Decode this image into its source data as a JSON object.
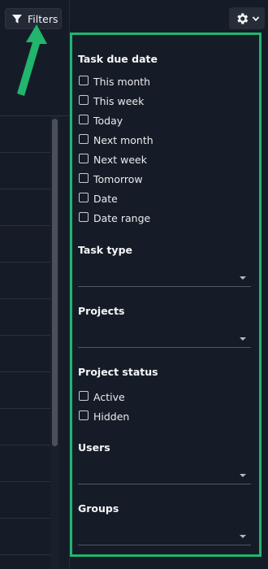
{
  "toolbar": {
    "filters_label": "Filters"
  },
  "filters": {
    "due_date": {
      "title": "Task due date",
      "options": [
        "This month",
        "This week",
        "Today",
        "Next month",
        "Next week",
        "Tomorrow",
        "Date",
        "Date range"
      ]
    },
    "task_type": {
      "title": "Task type"
    },
    "projects": {
      "title": "Projects"
    },
    "project_status": {
      "title": "Project status",
      "options": [
        "Active",
        "Hidden"
      ]
    },
    "users": {
      "title": "Users"
    },
    "groups": {
      "title": "Groups"
    }
  },
  "colors": {
    "background": "#161c27",
    "highlight_border": "#21b56e",
    "annotation_arrow": "#21b56e"
  },
  "icons": {
    "filter": "funnel-icon",
    "settings": "gear-icon",
    "dropdown": "chevron-down-icon"
  }
}
